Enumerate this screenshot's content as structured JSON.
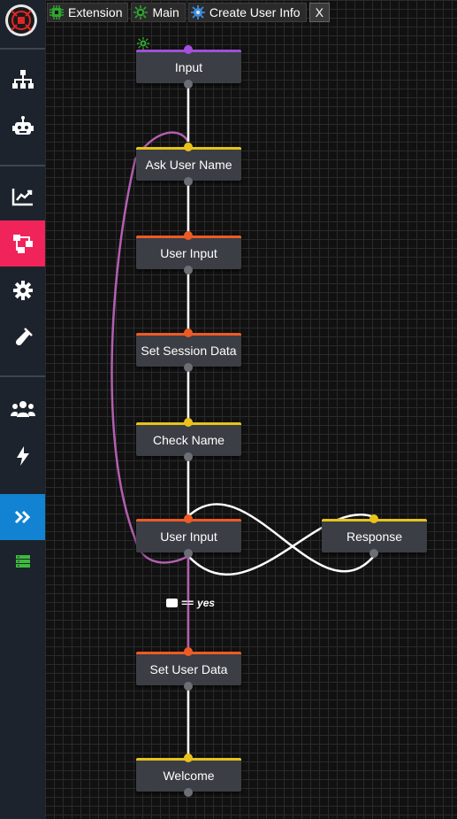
{
  "tabs": [
    {
      "label": "Extension",
      "icon": "extension-chip-icon"
    },
    {
      "label": "Main",
      "icon": "main-bug-icon"
    },
    {
      "label": "Create User Info",
      "icon": "flow-gear-icon"
    }
  ],
  "close_label": "X",
  "sidebar": {
    "items": [
      {
        "name": "sitemap",
        "icon": "sitemap-icon"
      },
      {
        "name": "bot",
        "icon": "robot-icon"
      },
      {
        "name": "analytics",
        "icon": "chart-line-icon"
      },
      {
        "name": "flows",
        "icon": "flow-nodes-icon",
        "active": true
      },
      {
        "name": "settings",
        "icon": "gear-icon"
      },
      {
        "name": "testing",
        "icon": "test-tube-icon"
      },
      {
        "name": "users",
        "icon": "users-icon"
      },
      {
        "name": "actions",
        "icon": "bolt-icon"
      },
      {
        "name": "expand",
        "icon": "double-chevron-right-icon"
      },
      {
        "name": "database",
        "icon": "database-icon"
      }
    ]
  },
  "nodes": [
    {
      "id": "input",
      "label": "Input",
      "color": "purple"
    },
    {
      "id": "ask_user_name",
      "label": "Ask User Name",
      "color": "yellow"
    },
    {
      "id": "user_input_1",
      "label": "User Input",
      "color": "orange"
    },
    {
      "id": "set_session_data",
      "label": "Set Session Data",
      "color": "orange"
    },
    {
      "id": "check_name",
      "label": "Check Name",
      "color": "yellow"
    },
    {
      "id": "user_input_2",
      "label": "User Input",
      "color": "orange"
    },
    {
      "id": "response",
      "label": "Response",
      "color": "yellow"
    },
    {
      "id": "set_user_data",
      "label": "Set User Data",
      "color": "orange"
    },
    {
      "id": "welcome",
      "label": "Welcome",
      "color": "yellow"
    }
  ],
  "condition": {
    "operator": "==",
    "value": "yes",
    "icon": "message-dots-icon"
  },
  "colors": {
    "purple": "#a44fe0",
    "yellow": "#eac21b",
    "orange": "#ee5a24",
    "sidebar_active": "#f0245a",
    "sidebar_expand": "#1283d2"
  }
}
